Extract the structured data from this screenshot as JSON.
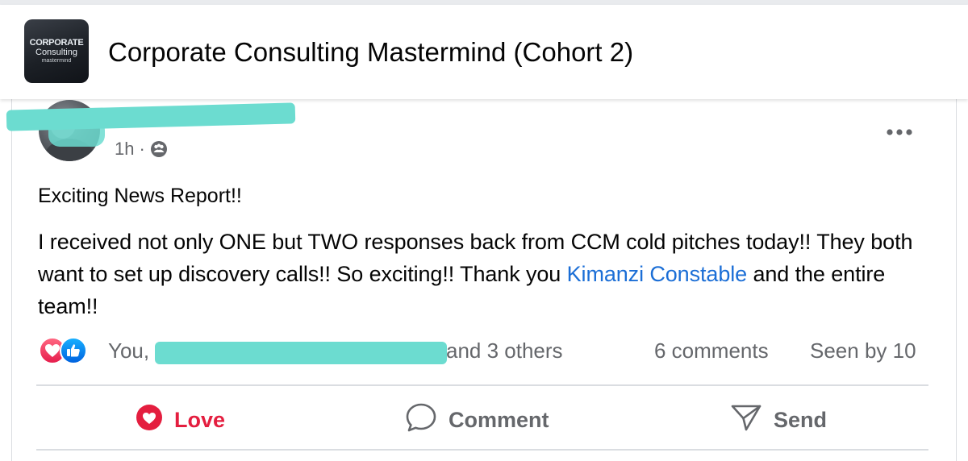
{
  "group": {
    "logo_line1": "CORPORATE",
    "logo_line2": "Consulting",
    "logo_line3": "mastermind",
    "name": "Corporate Consulting Mastermind (Cohort 2)"
  },
  "post": {
    "time": "1h",
    "separator": "·",
    "privacy_icon": "members-icon",
    "heading": "Exciting News Report!!",
    "body_part1": "I received not only ONE but TWO responses back from CCM cold pitches today!! They both want to set up discovery calls!! So exciting!! Thank you ",
    "mention": "Kimanzi Constable",
    "body_part2": " and the entire team!!"
  },
  "reactions": {
    "icons": [
      "love-icon",
      "like-icon"
    ],
    "you_text": "You,",
    "others_text": "and 3 others",
    "comments": "6 comments",
    "seen_by": "Seen by 10"
  },
  "actions": {
    "love_label": "Love",
    "comment_label": "Comment",
    "send_label": "Send"
  },
  "colors": {
    "love_red": "#e41e3f",
    "link_blue": "#1b6ed6",
    "meta_gray": "#65676b",
    "redaction": "#6cdcd0"
  }
}
